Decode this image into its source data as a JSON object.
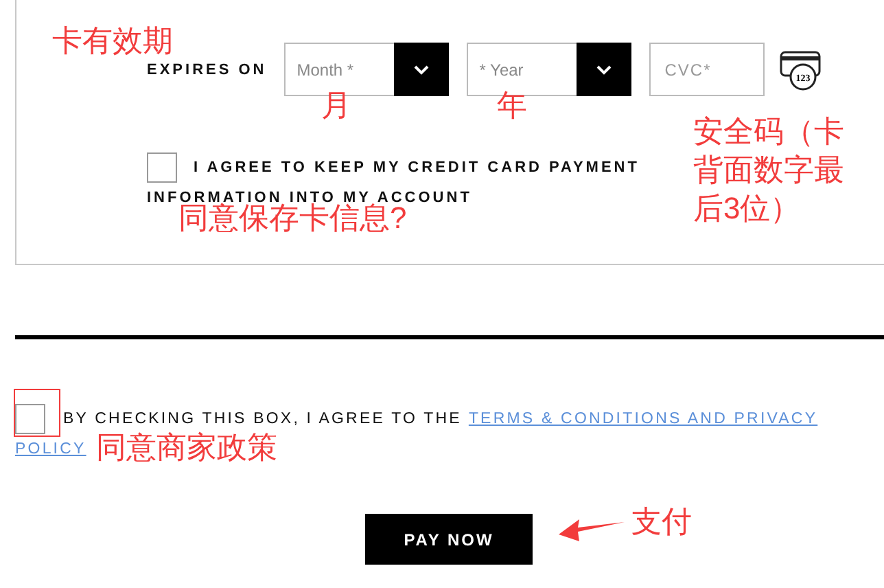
{
  "card_form": {
    "expires_label": "EXPIRES ON",
    "month_select": {
      "placeholder": "Month *"
    },
    "year_select": {
      "placeholder": "* Year"
    },
    "cvc_field": {
      "placeholder": "CVC*"
    },
    "cvc_icon_text": "123",
    "save_card": {
      "checked": false,
      "label_lines": [
        "I AGREE TO KEEP MY CREDIT CARD PAYMENT",
        "INFORMATION INTO MY ACCOUNT"
      ]
    }
  },
  "terms": {
    "checked": false,
    "text": "BY CHECKING THIS BOX, I AGREE TO THE",
    "link_lines": [
      "TERMS & CONDITIONS AND PRIVACY",
      "POLICY"
    ]
  },
  "pay_button": "PAY NOW",
  "annotations": [
    {
      "kind": "text",
      "text": "卡有效期"
    },
    {
      "kind": "text",
      "text": "月"
    },
    {
      "kind": "text",
      "text": "年"
    },
    {
      "kind": "text",
      "text": "同意保存卡信息?"
    },
    {
      "kind": "text",
      "text": "安全码（卡背面数字最后3位）"
    },
    {
      "kind": "box"
    },
    {
      "kind": "text",
      "text": "同意商家政策"
    },
    {
      "kind": "arrow"
    },
    {
      "kind": "text",
      "text": "支付"
    }
  ]
}
